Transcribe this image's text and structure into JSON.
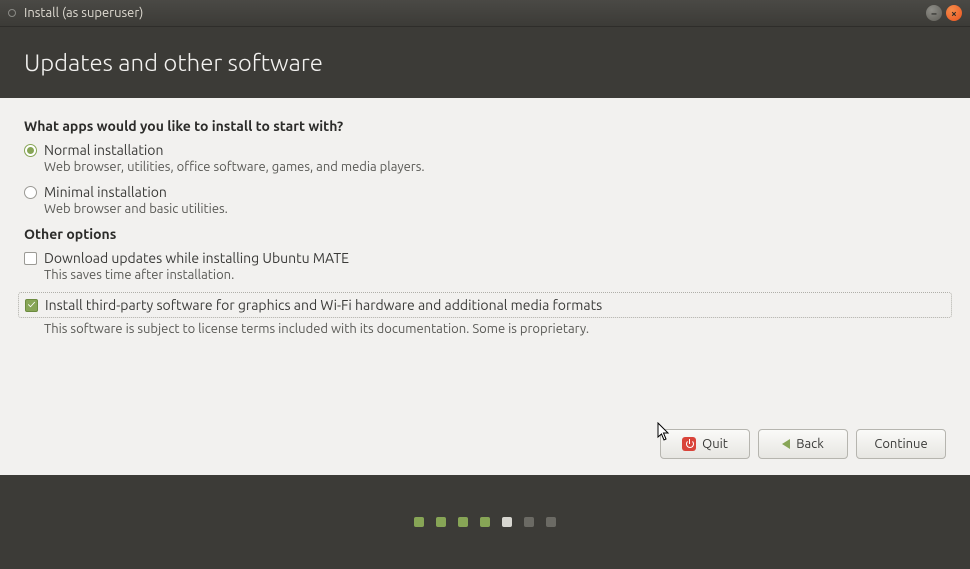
{
  "window": {
    "title": "Install (as superuser)"
  },
  "header": {
    "title": "Updates and other software"
  },
  "section1": {
    "heading": "What apps would you like to install to start with?",
    "normal": {
      "label": "Normal installation",
      "desc": "Web browser, utilities, office software, games, and media players.",
      "checked": true
    },
    "minimal": {
      "label": "Minimal installation",
      "desc": "Web browser and basic utilities.",
      "checked": false
    }
  },
  "section2": {
    "heading": "Other options",
    "updates": {
      "label": "Download updates while installing Ubuntu MATE",
      "desc": "This saves time after installation.",
      "checked": false
    },
    "thirdparty": {
      "label": "Install third-party software for graphics and Wi-Fi hardware and additional media formats",
      "desc": "This software is subject to license terms included with its documentation. Some is proprietary.",
      "checked": true
    }
  },
  "buttons": {
    "quit": "Quit",
    "back": "Back",
    "continue": "Continue"
  },
  "progress": {
    "total": 7,
    "current_index": 4,
    "states": [
      "done",
      "done",
      "done",
      "done",
      "current",
      "todo",
      "todo"
    ]
  }
}
